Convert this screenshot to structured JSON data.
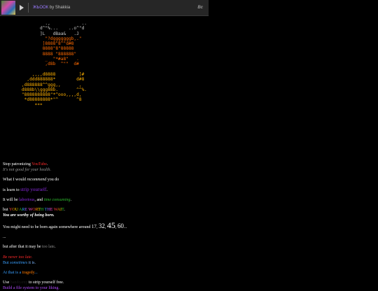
{
  "player": {
    "track_title": "ЖЬООК",
    "track_by": " by ",
    "artist": "Shakkia",
    "brand": "Bc"
  },
  "colors": {
    "ascii_top": "#c9c9c9",
    "ascii_mid": "#ff6a00",
    "ascii_bottom": "#ffb000"
  },
  "ascii": [
    "             .,            ..",
    "           d^\"%...    ..o^\"d",
    "           ]L   dBaa&   .J",
    "             \"?dgggggggb,.\"",
    "            ]8888\"8^\"d#8",
    "            8888\"8\"88888",
    "            8888 \"888888\"",
    "             _  \"*#a8\"   .",
    "             ,d8b  ^\"\"  d#",
    "",
    "        ,,,,d8888         ]#",
    "      ,ddd888888*        d#8",
    "    ,d888888^^ggg,,       ,",
    "    d888b\\\\ggg88b.       ^^%.",
    "    \"8888888888\"*^ooo,,,,d,",
    "     *d88888888*\"^       ^8",
    "         ***"
  ],
  "lines": {
    "l1a": "Stop patronizing ",
    "l1b": "YouTube",
    "l1c": ".",
    "l2": "It's not good for your health.",
    "l3a": "What I would ",
    "l3b": "recommend",
    "l3c": " you do",
    "l4a": "is learn to ",
    "l4b": "strip yourself",
    "l4c": ".",
    "l5a": "It will be ",
    "l5b": "laborious",
    "l5c": ", and ",
    "l5d": "time consuming",
    "l5e": ".",
    "l6a": "but ",
    "l6_rainbow": [
      "Y",
      "O",
      "U ",
      "A",
      "R",
      "E ",
      "W",
      "O",
      "R",
      "T",
      "H ",
      "T",
      "H",
      "E ",
      "W",
      "A",
      "I",
      "T"
    ],
    "l6c": ".",
    "l7": "You are worthy of being born.",
    "l8a": "You might need to be born again somewhere around ",
    "n1": "17",
    "sep1": ", ",
    "n2": "32",
    "sep2": ", ",
    "n3": "45",
    "sep3": ", ",
    "n4": "60",
    "l8b": "...",
    "l9": "...",
    "l10a": "but after that it may be ",
    "l10b": "too late",
    "l10c": ".",
    "l11": "Be never too late.",
    "l12a": "But ",
    "l12b": "sometimes",
    "l12c": " it is.",
    "l13a": "At that is a ",
    "l13b": "tragedy",
    "l13c": "...",
    "l14a": "Use ",
    "l14b": "bandcamp",
    "l14c": " to strip yourself free.",
    "l15": "Build a file system to your liking."
  }
}
